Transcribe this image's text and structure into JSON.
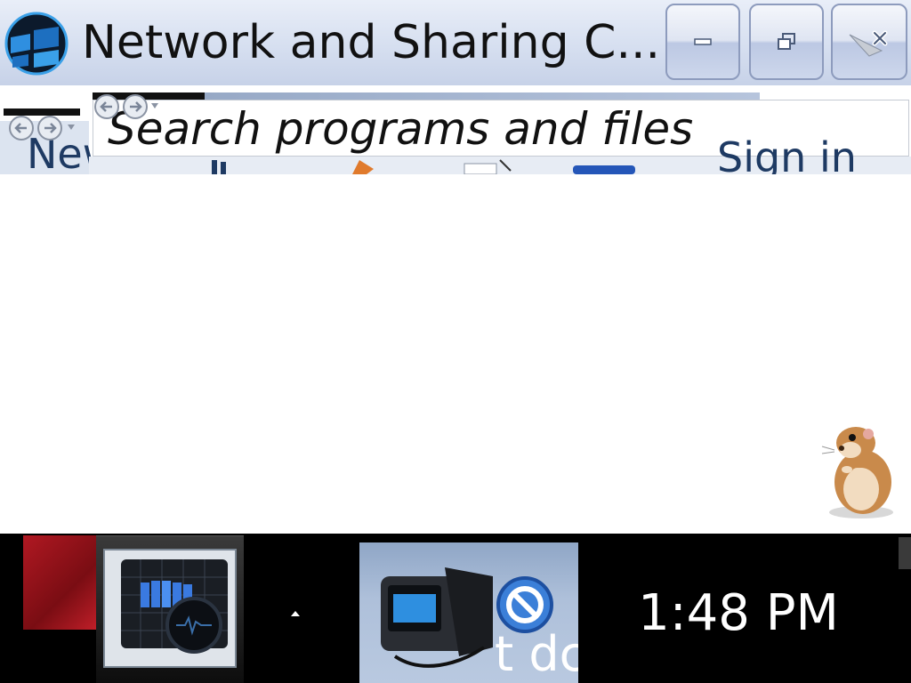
{
  "window": {
    "title": "Network and Sharing C...",
    "app_icon": "network-center-icon",
    "controls": {
      "minimize_icon": "minimize-icon",
      "maximize_icon": "restore-icon",
      "close_icon": "close-icon"
    }
  },
  "toolbar": {
    "back_icon": "back-arrow-icon",
    "forward_icon": "forward-arrow-icon",
    "search_placeholder": "Search programs and files",
    "new_label": "New",
    "signin_label": "Sign in"
  },
  "content": {
    "desktop_pet_icon": "hamster-icon"
  },
  "taskbar": {
    "clock": "1:48 PM",
    "overflow_text": "t dc",
    "tray_arrow_icon": "show-hidden-icons-icon",
    "app1_icon": "equalizer-app-icon",
    "app2_icon": "camcorder-app-icon",
    "app2_badge_icon": "stop-sign-icon"
  },
  "colors": {
    "titlebar_top": "#e9eef8",
    "titlebar_bottom": "#c7d2e8",
    "taskbar": "#000000",
    "accent_blue": "#1e3a63",
    "red_tile": "#b01822"
  }
}
